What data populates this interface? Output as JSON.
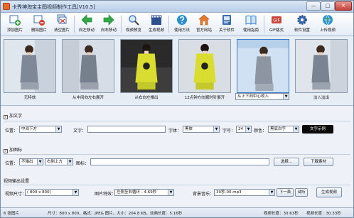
{
  "window": {
    "title": "卡秀神淘宝主图视频制作工具[V10.5]",
    "minimize": "—",
    "maximize": "□",
    "close": "✕"
  },
  "toolbar": {
    "buttons": [
      {
        "label": "添加图片",
        "icon": "add-image-icon",
        "color": "#2f9a3a"
      },
      {
        "label": "删除图片",
        "icon": "delete-image-icon",
        "color": "#3a6fb7"
      },
      {
        "label": "清空图片",
        "icon": "clear-images-icon",
        "color": "#3a6fb7"
      },
      {
        "label": "向左移动",
        "icon": "arrow-left-icon",
        "color": "#34a846"
      },
      {
        "label": "向右移动",
        "icon": "arrow-right-icon",
        "color": "#34a846"
      },
      {
        "label": "视频预览",
        "icon": "magnifier-icon",
        "color": "#4d7fc4"
      },
      {
        "label": "生成视频",
        "icon": "clapperboard-icon",
        "color": "#2f4f8f"
      },
      {
        "label": "使用方法",
        "icon": "help-icon",
        "color": "#2d8fd0"
      },
      {
        "label": "官方网站",
        "icon": "home-icon",
        "color": "#e07a2c"
      },
      {
        "label": "关于软件",
        "icon": "info-icon",
        "color": "#3b6db3"
      },
      {
        "label": "使用指南",
        "icon": "book-icon",
        "color": "#2f7fd0"
      },
      {
        "label": "GIF格式",
        "icon": "gif-icon",
        "color": "#c8473a"
      },
      {
        "label": "软件设置",
        "icon": "gear-icon",
        "color": "#3d6fb8"
      },
      {
        "label": "上传视频",
        "icon": "upload-icon",
        "color": "#2f8fd0"
      }
    ]
  },
  "thumbs": [
    {
      "caption": "无特效",
      "bg": "#dfe6ee",
      "dress": "#7f8896"
    },
    {
      "caption": "从中间向左右展开",
      "bg": "#d7dde6",
      "dress": "#767f8c"
    },
    {
      "caption": "从右向左推出",
      "bg": "#2a2a2a",
      "dress": "#d8dd2f"
    },
    {
      "caption": "12点钟方向顺时针展开",
      "bg": "#d9dee5",
      "dress": "#d8dd2f"
    },
    {
      "caption": "从上下向中心收入",
      "bg": "#cfe1f2",
      "dress": "#8d95a2"
    },
    {
      "caption": "淡入淡出",
      "bg": "#e0e5ec",
      "dress": "#7a8391"
    }
  ],
  "text_section": {
    "title": "加文字",
    "position_label": "位置：",
    "position_value": "中间下方",
    "text_label": "文字：",
    "text_value": "",
    "font_label": "字体：",
    "font_value": "黑体",
    "size_label": "字号：",
    "size_value": "24",
    "color_label": "颜色：",
    "color_value": "黑底白字",
    "sample_label": "文字示例"
  },
  "icon_section": {
    "title": "加图标",
    "position_label": "位置：",
    "position_value": "不输出",
    "corner_value": "右侧上方",
    "icon_label": "图标：",
    "icon_value": "",
    "choose_label": "选择...",
    "download_label": "下载素材"
  },
  "output_section": {
    "title": "视频输出设置",
    "size_label": "视频尺寸：",
    "size_value": "( 800 x 800)",
    "effect_label": "图片特效：",
    "effect_value": "左侧至右循环 - 4.69秒",
    "music_label": "背景音乐：",
    "music_value": "30秒-00.mp3",
    "next_label": "下一首",
    "play_label": "试听",
    "generate_label": "生成视频"
  },
  "status": {
    "count": "6 张图片",
    "spec": "尺寸：800 x 800，格式：JPEG 图片，大小：204.8 KB，动画长度：5.16秒",
    "video_length": "视频长度：30.63秒",
    "total_length": "视频长度：30.33秒"
  }
}
